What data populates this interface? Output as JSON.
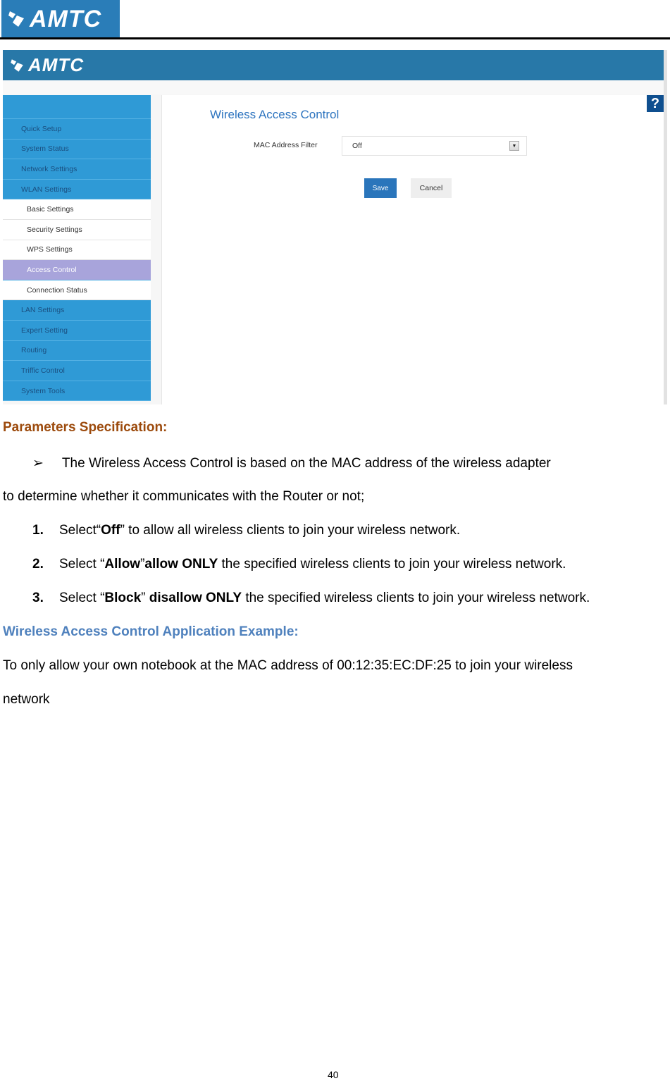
{
  "page_header": {
    "logo_text": "AMTC",
    "logo_icon": "amtc-logo-icon"
  },
  "screenshot": {
    "topbar": {
      "logo_text": "AMTC"
    },
    "sidebar": {
      "items": [
        {
          "label": "Quick Setup",
          "type": "main"
        },
        {
          "label": "System Status",
          "type": "main"
        },
        {
          "label": "Network Settings",
          "type": "main"
        },
        {
          "label": "WLAN Settings",
          "type": "main"
        },
        {
          "label": "Basic Settings",
          "type": "sub"
        },
        {
          "label": "Security Settings",
          "type": "sub"
        },
        {
          "label": "WPS Settings",
          "type": "sub"
        },
        {
          "label": "Access Control",
          "type": "active"
        },
        {
          "label": "Connection Status",
          "type": "sub"
        },
        {
          "label": "LAN Settings",
          "type": "main"
        },
        {
          "label": "Expert Setting",
          "type": "main"
        },
        {
          "label": "Routing",
          "type": "main"
        },
        {
          "label": "Triffic Control",
          "type": "main"
        },
        {
          "label": "System Tools",
          "type": "main"
        }
      ]
    },
    "content": {
      "title": "Wireless Access Control",
      "mac_filter_label": "MAC Address Filter",
      "mac_filter_value": "Off",
      "save_label": "Save",
      "cancel_label": "Cancel",
      "help_label": "?"
    },
    "colors": {
      "topbar": "#2878a8",
      "nav": "#2f9ad6",
      "active": "#a8a4db",
      "save": "#2a75bb"
    }
  },
  "doc": {
    "param_heading": "Parameters Specification:",
    "bullet_glyph": "➢",
    "bullet_text": "The Wireless Access Control is based on the MAC address of the wireless adapter",
    "bullet_cont": "to determine whether it communicates with the Router or not;",
    "items": [
      {
        "num": "1.",
        "pre": "Select“",
        "b1": "Off",
        "mid": "” to allow all wireless clients to join your wireless network.",
        "b2": "",
        "post": ""
      },
      {
        "num": "2.",
        "pre": "Select “",
        "b1": "Allow",
        "mid": "”",
        "b2": "allow ONLY",
        "post": " the specified wireless clients to join your wireless network."
      },
      {
        "num": "3.",
        "pre": "Select “",
        "b1": "Block",
        "mid": "” ",
        "b2": "disallow ONLY",
        "post": " the specified wireless clients to join your wireless network."
      }
    ],
    "example_heading": "Wireless Access Control Application Example:",
    "example_text_1": "To only allow your own notebook at the MAC address of 00:12:35:EC:DF:25 to join your wireless",
    "example_text_2": "network",
    "page_number": "40"
  }
}
